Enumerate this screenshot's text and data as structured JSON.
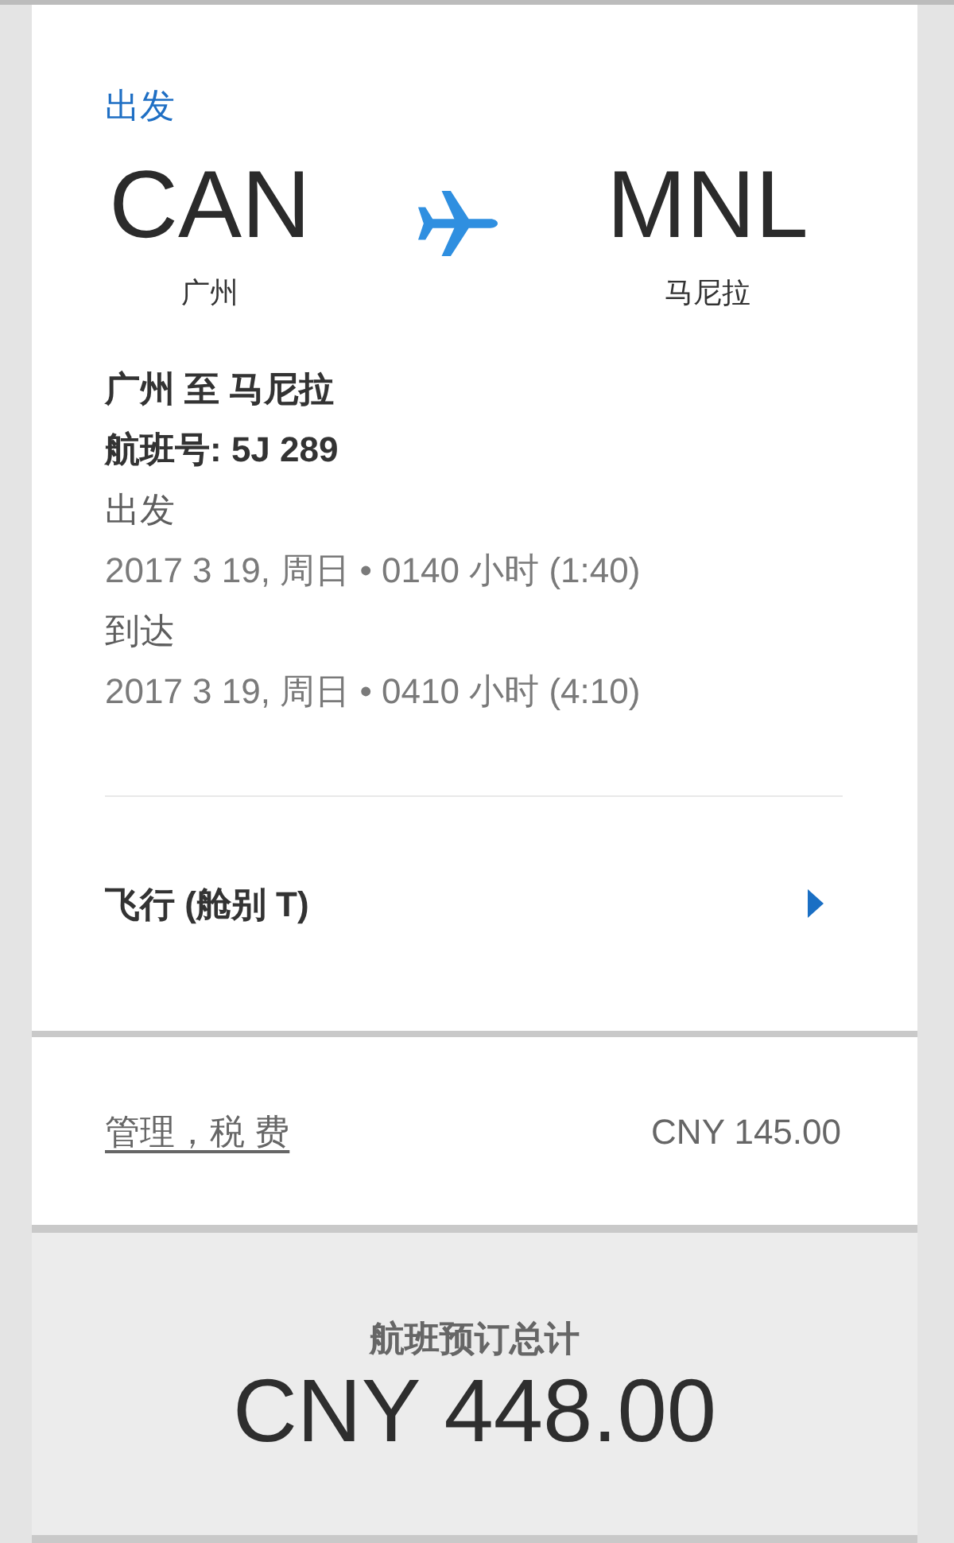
{
  "departure_label": "出发",
  "origin": {
    "code": "CAN",
    "city": "广州"
  },
  "destination": {
    "code": "MNL",
    "city": "马尼拉"
  },
  "route": "广州 至 马尼拉",
  "flight_number": "航班号: 5J 289",
  "schedule": [
    {
      "label": "出发",
      "datetime": "2017 3 19, 周日 • 0140 小时 (1:40)"
    },
    {
      "label": "到达",
      "datetime": "2017 3 19, 周日 • 0410 小时 (4:10)"
    }
  ],
  "fare": {
    "label": "飞行 (舱别 T)",
    "expanded": false
  },
  "fees": {
    "label": "管理，税 费",
    "amount": "CNY 145.00"
  },
  "total": {
    "label": "航班预订总计",
    "amount": "CNY 448.00"
  }
}
